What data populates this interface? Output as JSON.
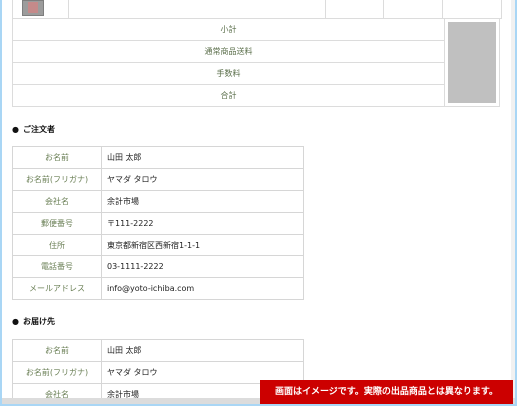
{
  "summary": {
    "rows": [
      {
        "label": "小計"
      },
      {
        "label": "通常商品送料"
      },
      {
        "label": "手数料"
      },
      {
        "label": "合計"
      }
    ]
  },
  "orderer": {
    "title": "ご注文者",
    "rows": [
      {
        "label": "お名前",
        "value": "山田 太郎"
      },
      {
        "label": "お名前(フリガナ)",
        "value": "ヤマダ タロウ"
      },
      {
        "label": "会社名",
        "value": "余計市場"
      },
      {
        "label": "郵便番号",
        "value": "〒111-2222"
      },
      {
        "label": "住所",
        "value": "東京都新宿区西新宿1-1-1"
      },
      {
        "label": "電話番号",
        "value": "03-1111-2222"
      },
      {
        "label": "メールアドレス",
        "value": "info@yoto-ichiba.com"
      }
    ]
  },
  "delivery": {
    "title": "お届け先",
    "rows": [
      {
        "label": "お名前",
        "value": "山田 太郎"
      },
      {
        "label": "お名前(フリガナ)",
        "value": "ヤマダ タロウ"
      },
      {
        "label": "会社名",
        "value": "余計市場"
      }
    ]
  },
  "disclaimer": "画面はイメージです。実際の出品商品とは異なります。"
}
